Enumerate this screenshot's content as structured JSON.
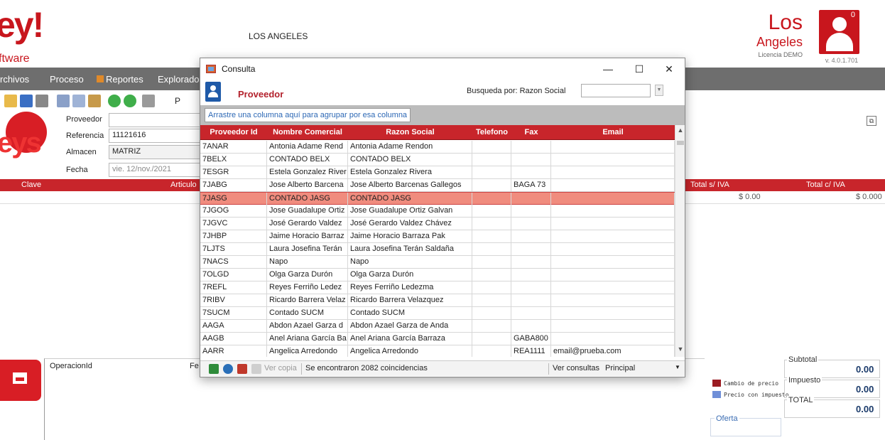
{
  "app": {
    "logo_top_text": "ey!",
    "logo_top_small": "ftware",
    "branch": "LOS ANGELES",
    "brand_line1": "Los",
    "brand_line2": "Angeles",
    "license": "Licencia DEMO",
    "version": "v. 4.0.1.701",
    "notif_count": "0",
    "logo_mid_text": "eys"
  },
  "menu": {
    "archivos": "rchivos",
    "proceso": "Proceso",
    "reportes": "Reportes",
    "explorador": "Explorador",
    "toolbar_overflow": "P"
  },
  "form": {
    "proveedor_label": "Proveedor",
    "proveedor_value": "",
    "referencia_label": "Referencia",
    "referencia_value": "11121616",
    "almacen_label": "Almacen",
    "almacen_value": "MATRIZ",
    "fecha_label": "Fecha",
    "fecha_value": "vie. 12/nov./2021"
  },
  "main_grid": {
    "col_clave": "Clave",
    "col_articulo": "Articulo",
    "col_total_sin": "Total s/ IVA",
    "col_total_con": "Total c/ IVA",
    "row_total_sin": "$ 0.00",
    "row_total_con": "$ 0.000"
  },
  "bottom": {
    "operacion_label": "OperacionId",
    "fe_label": "Fe",
    "legend_cambio": "Cambio de precio",
    "legend_precio": "Precio con impuesto",
    "oferta": "Oferta",
    "subtotal_label": "Subtotal",
    "subtotal_value": "0.00",
    "impuesto_label": "Impuesto",
    "impuesto_value": "0.00",
    "total_label": "TOTAL",
    "total_value": "0.00",
    "legend_colors": {
      "cambio": "#9b1c22",
      "precio": "#6f8fd8"
    }
  },
  "dialog": {
    "title": "Consulta",
    "minimize": "—",
    "maximize": "☐",
    "close": "✕",
    "header_title": "Proveedor",
    "busqueda_label": "Busqueda por: Razon Social",
    "group_hint": "Arrastre una columna aquí para agrupar por esa columna",
    "columns": [
      "Proveedor Id",
      "Nombre Comercial",
      "Razon Social",
      "Telefono",
      "Fax",
      "Email"
    ],
    "rows": [
      [
        "7ANAR",
        "Antonia Adame Rend",
        "Antonia Adame Rendon",
        "",
        "",
        ""
      ],
      [
        "7BELX",
        "CONTADO BELX",
        "CONTADO BELX",
        "",
        "",
        ""
      ],
      [
        "7ESGR",
        "Estela Gonzalez River",
        "Estela Gonzalez Rivera",
        "",
        "",
        ""
      ],
      [
        "7JABG",
        "Jose Alberto Barcena",
        "Jose Alberto Barcenas Gallegos",
        "",
        "BAGA 73",
        ""
      ],
      [
        "7JASG",
        "CONTADO JASG",
        "CONTADO JASG",
        "",
        "",
        ""
      ],
      [
        "7JGOG",
        "Jose Guadalupe Ortiz",
        "Jose Guadalupe Ortiz Galvan",
        "",
        "",
        ""
      ],
      [
        "7JGVC",
        "José Gerardo Valdez",
        "José Gerardo Valdez Chávez",
        "",
        "",
        ""
      ],
      [
        "7JHBP",
        "Jaime Horacio Barraz",
        "Jaime Horacio Barraza Pak",
        "",
        "",
        ""
      ],
      [
        "7LJTS",
        "Laura Josefina Terán",
        "Laura Josefina Terán Saldaña",
        "",
        "",
        ""
      ],
      [
        "7NACS",
        "Napo",
        "Napo",
        "",
        "",
        ""
      ],
      [
        "7OLGD",
        "Olga Garza Durón",
        "Olga Garza Durón",
        "",
        "",
        ""
      ],
      [
        "7REFL",
        "Reyes Ferriño Ledez",
        "Reyes Ferriño Ledezma",
        "",
        "",
        ""
      ],
      [
        "7RIBV",
        "Ricardo Barrera Velaz",
        "Ricardo Barrera Velazquez",
        "",
        "",
        ""
      ],
      [
        "7SUCM",
        "Contado SUCM",
        "Contado SUCM",
        "",
        "",
        ""
      ],
      [
        "AAGA",
        "Abdon Azael Garza d",
        "Abdon Azael Garza de Anda",
        "",
        "",
        ""
      ],
      [
        "AAGB",
        "Anel Ariana García Ba",
        "Anel Ariana García Barraza",
        "",
        "GABA800",
        ""
      ],
      [
        "AARR",
        "Angelica Arredondo",
        "Angelica Arredondo",
        "",
        "REA1111",
        "email@prueba.com"
      ]
    ],
    "selected_row": 4,
    "status_ver_copia": "Ver copia",
    "status_count": "Se encontraron 2082 coincidencias",
    "status_ver_consultas": "Ver consultas",
    "status_principal": "Principal",
    "selected_color": "#f08c7e",
    "header_color": "#c8252b"
  }
}
